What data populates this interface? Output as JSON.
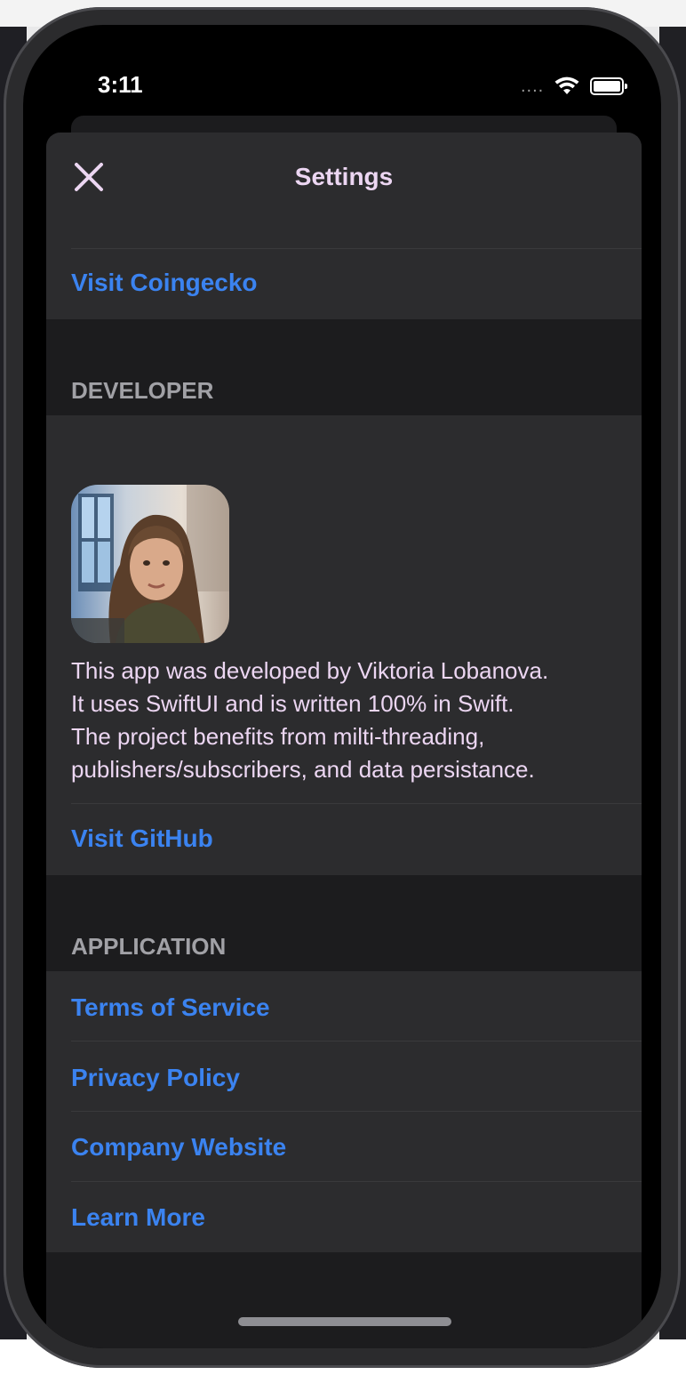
{
  "status_bar": {
    "time": "3:11",
    "signal": "....",
    "wifi_icon": "wifi-icon",
    "battery_icon": "battery-icon"
  },
  "nav": {
    "title": "Settings",
    "close_icon": "close-icon"
  },
  "coingecko": {
    "link": "Visit Coingecko"
  },
  "developer": {
    "header": "DEVELOPER",
    "description_lines": [
      "This app was developed by Viktoria Lobanova.",
      "It uses SwiftUI and is written 100% in Swift.",
      "The project benefits from milti-threading,",
      "publishers/subscribers, and data persistance."
    ],
    "github_link": "Visit GitHub"
  },
  "application": {
    "header": "APPLICATION",
    "links": [
      "Terms of Service",
      "Privacy Policy",
      "Company Website",
      "Learn More"
    ]
  },
  "colors": {
    "accent_link": "#3b83f0",
    "title_text": "#ecd6f2",
    "section_header": "#a1a1a6",
    "row_bg": "#2c2c2e",
    "sheet_bg": "#1c1c1e"
  }
}
